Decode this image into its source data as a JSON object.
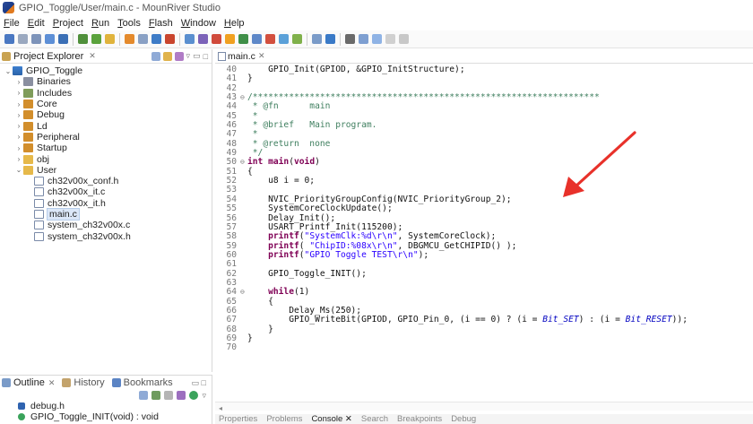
{
  "window": {
    "title": "GPIO_Toggle/User/main.c - MounRiver Studio"
  },
  "menubar": {
    "items": [
      {
        "acc": "F",
        "rest": "ile"
      },
      {
        "acc": "E",
        "rest": "dit"
      },
      {
        "acc": "P",
        "rest": "roject"
      },
      {
        "acc": "R",
        "rest": "un"
      },
      {
        "acc": "T",
        "rest": "ools"
      },
      {
        "acc": "F",
        "rest": "lash"
      },
      {
        "acc": "W",
        "rest": "indow"
      },
      {
        "acc": "H",
        "rest": "elp"
      }
    ]
  },
  "project_explorer": {
    "title": "Project Explorer",
    "close": "✕",
    "tree": [
      {
        "label": "GPIO_Toggle",
        "twisty": "⌄",
        "icon": "project-icon",
        "depth": 0
      },
      {
        "label": "Binaries",
        "twisty": "›",
        "icon": "binaries-icon",
        "depth": 1
      },
      {
        "label": "Includes",
        "twisty": "›",
        "icon": "includes-icon",
        "depth": 1
      },
      {
        "label": "Core",
        "twisty": "›",
        "icon": "source-folder-icon",
        "depth": 1
      },
      {
        "label": "Debug",
        "twisty": "›",
        "icon": "source-folder-icon",
        "depth": 1
      },
      {
        "label": "Ld",
        "twisty": "›",
        "icon": "source-folder-icon",
        "depth": 1
      },
      {
        "label": "Peripheral",
        "twisty": "›",
        "icon": "source-folder-icon",
        "depth": 1
      },
      {
        "label": "Startup",
        "twisty": "›",
        "icon": "source-folder-icon",
        "depth": 1
      },
      {
        "label": "obj",
        "twisty": "›",
        "icon": "folder-icon",
        "depth": 1
      },
      {
        "label": "User",
        "twisty": "⌄",
        "icon": "folder-icon",
        "depth": 1
      },
      {
        "label": "ch32v00x_conf.h",
        "twisty": "",
        "icon": "file-icon",
        "depth": 2
      },
      {
        "label": "ch32v00x_it.c",
        "twisty": "",
        "icon": "file-icon",
        "depth": 2
      },
      {
        "label": "ch32v00x_it.h",
        "twisty": "",
        "icon": "file-icon",
        "depth": 2
      },
      {
        "label": "main.c",
        "twisty": "",
        "icon": "file-icon",
        "depth": 2,
        "selected": true
      },
      {
        "label": "system_ch32v00x.c",
        "twisty": "",
        "icon": "file-icon",
        "depth": 2
      },
      {
        "label": "system_ch32v00x.h",
        "twisty": "",
        "icon": "file-icon",
        "depth": 2
      }
    ]
  },
  "outline": {
    "tabs": [
      {
        "label": "Outline",
        "close": "✕"
      },
      {
        "label": "History"
      },
      {
        "label": "Bookmarks"
      }
    ],
    "items": [
      {
        "label": "debug.h"
      },
      {
        "label": "GPIO_Toggle_INIT(void) : void"
      }
    ]
  },
  "editor": {
    "tab": {
      "label": "main.c",
      "close": "✕"
    },
    "lines": [
      {
        "n": "40",
        "fold": "",
        "parts": [
          [
            "src",
            "    GPIO_Init(GPIOD, &GPIO_InitStructure);"
          ]
        ]
      },
      {
        "n": "41",
        "fold": "",
        "parts": [
          [
            "src",
            "}"
          ]
        ]
      },
      {
        "n": "42",
        "fold": "",
        "parts": []
      },
      {
        "n": "43",
        "fold": "⊖",
        "parts": [
          [
            "cmt",
            "/*******************************************************************"
          ]
        ]
      },
      {
        "n": "44",
        "fold": "",
        "parts": [
          [
            "cmt",
            " * @fn      main"
          ]
        ]
      },
      {
        "n": "45",
        "fold": "",
        "parts": [
          [
            "cmt",
            " *"
          ]
        ]
      },
      {
        "n": "46",
        "fold": "",
        "parts": [
          [
            "cmt",
            " * @brief   Main program."
          ]
        ]
      },
      {
        "n": "47",
        "fold": "",
        "parts": [
          [
            "cmt",
            " *"
          ]
        ]
      },
      {
        "n": "48",
        "fold": "",
        "parts": [
          [
            "cmt",
            " * @return  none"
          ]
        ]
      },
      {
        "n": "49",
        "fold": "",
        "parts": [
          [
            "cmt",
            " */"
          ]
        ]
      },
      {
        "n": "50",
        "fold": "⊖",
        "parts": [
          [
            "kw",
            "int"
          ],
          [
            "src",
            " "
          ],
          [
            "kw",
            "main"
          ],
          [
            "src",
            "("
          ],
          [
            "kw",
            "void"
          ],
          [
            "src",
            ")"
          ]
        ]
      },
      {
        "n": "51",
        "fold": "",
        "parts": [
          [
            "src",
            "{"
          ]
        ]
      },
      {
        "n": "52",
        "fold": "",
        "parts": [
          [
            "src",
            "    u8 i = 0;"
          ]
        ]
      },
      {
        "n": "53",
        "fold": "",
        "parts": []
      },
      {
        "n": "54",
        "fold": "",
        "parts": [
          [
            "src",
            "    NVIC_PriorityGroupConfig(NVIC_PriorityGroup_2);"
          ]
        ]
      },
      {
        "n": "55",
        "fold": "",
        "parts": [
          [
            "src",
            "    SystemCoreClockUpdate();"
          ]
        ]
      },
      {
        "n": "56",
        "fold": "",
        "parts": [
          [
            "src",
            "    Delay_Init();"
          ]
        ]
      },
      {
        "n": "57",
        "fold": "",
        "parts": [
          [
            "src",
            "    USART_Printf_Init(115200);"
          ]
        ]
      },
      {
        "n": "58",
        "fold": "",
        "parts": [
          [
            "kw",
            "    printf"
          ],
          [
            "src",
            "("
          ],
          [
            "str",
            "\"SystemClk:%d\\r\\n\""
          ],
          [
            "src",
            ", SystemCoreClock);"
          ]
        ]
      },
      {
        "n": "59",
        "fold": "",
        "parts": [
          [
            "kw",
            "    printf"
          ],
          [
            "src",
            "( "
          ],
          [
            "str",
            "\"ChipID:%08x\\r\\n\""
          ],
          [
            "src",
            ", DBGMCU_GetCHIPID() );"
          ]
        ]
      },
      {
        "n": "60",
        "fold": "",
        "parts": [
          [
            "kw",
            "    printf"
          ],
          [
            "src",
            "("
          ],
          [
            "str",
            "\"GPIO Toggle TEST\\r\\n\""
          ],
          [
            "src",
            ");"
          ]
        ]
      },
      {
        "n": "61",
        "fold": "",
        "parts": []
      },
      {
        "n": "62",
        "fold": "",
        "parts": [
          [
            "src",
            "    GPIO_Toggle_INIT();"
          ]
        ]
      },
      {
        "n": "63",
        "fold": "",
        "parts": []
      },
      {
        "n": "64",
        "fold": "⊖",
        "parts": [
          [
            "kw",
            "    while"
          ],
          [
            "src",
            "(1)"
          ]
        ]
      },
      {
        "n": "65",
        "fold": "",
        "parts": [
          [
            "src",
            "    {"
          ]
        ]
      },
      {
        "n": "66",
        "fold": "",
        "parts": [
          [
            "src",
            "        Delay_Ms(250);"
          ]
        ]
      },
      {
        "n": "67",
        "fold": "",
        "parts": [
          [
            "src",
            "        GPIO_WriteBit(GPIOD, GPIO_Pin_0, (i == 0) ? (i = "
          ],
          [
            "it",
            "Bit_SET"
          ],
          [
            "src",
            ") : (i = "
          ],
          [
            "it",
            "Bit_RESET"
          ],
          [
            "src",
            "));"
          ]
        ]
      },
      {
        "n": "68",
        "fold": "",
        "parts": [
          [
            "src",
            "    }"
          ]
        ]
      },
      {
        "n": "69",
        "fold": "",
        "parts": [
          [
            "src",
            "}"
          ]
        ]
      },
      {
        "n": "70",
        "fold": "",
        "parts": []
      }
    ]
  },
  "bottom_panel": {
    "tabs": [
      {
        "label": "Properties"
      },
      {
        "label": "Problems"
      },
      {
        "label": "Console ✕",
        "active": true
      },
      {
        "label": "Search"
      },
      {
        "label": "Breakpoints"
      },
      {
        "label": "Debug"
      }
    ]
  },
  "colors": {
    "annotation_arrow": "#e8312a",
    "comment": "#3f7f5f",
    "keyword": "#7f0055",
    "string": "#2a00ff"
  }
}
